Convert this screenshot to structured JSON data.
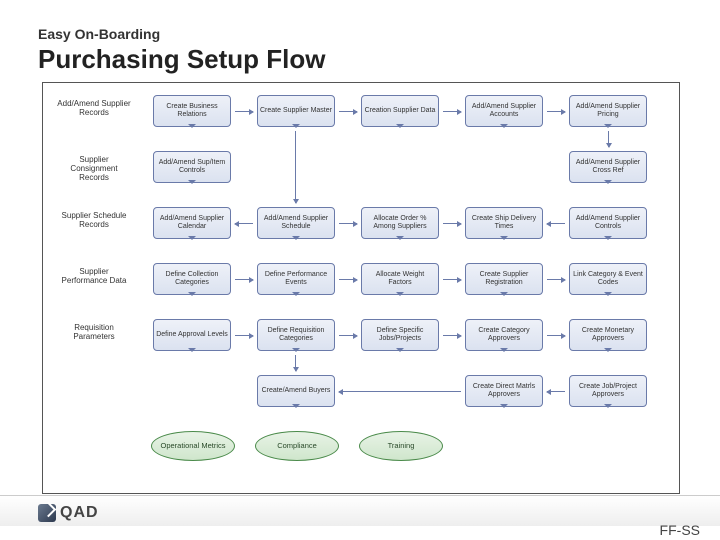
{
  "subtitle": "Easy On-Boarding",
  "title": "Purchasing Setup Flow",
  "logo": "QAD",
  "code": "FF-SS",
  "rowLabels": [
    "Add/Amend Supplier Records",
    "Supplier Consignment Records",
    "Supplier Schedule Records",
    "Supplier Performance Data",
    "Requisition Parameters"
  ],
  "rows": [
    [
      "Create Business Relations",
      "Create Supplier Master",
      "Creation Supplier Data",
      "Add/Amend Supplier Accounts",
      "Add/Amend Supplier Pricing"
    ],
    [
      "Add/Amend Sup/Item Controls",
      "",
      "",
      "",
      "Add/Amend Supplier Cross Ref"
    ],
    [
      "Add/Amend Supplier Calendar",
      "Add/Amend Supplier Schedule",
      "Allocate Order % Among Suppliers",
      "Create Ship Delivery Times",
      "Add/Amend Supplier Controls"
    ],
    [
      "Define Collection Categories",
      "Define Performance Events",
      "Allocate Weight Factors",
      "Create Supplier Registration",
      "Link Category & Event Codes"
    ],
    [
      "Define Approval Levels",
      "Define Requisition Categories",
      "Define Specific Jobs/Projects",
      "Create Category Approvers",
      "Create Monetary Approvers"
    ],
    [
      "",
      "Create/Amend Buyers",
      "",
      "Create Direct Matrls Approvers",
      "Create Job/Project Approvers"
    ]
  ],
  "ovals": [
    "Operational Metrics",
    "Compliance",
    "Training"
  ],
  "chart_data": {
    "type": "flowchart",
    "title": "Purchasing Setup Flow",
    "swimlanes": [
      {
        "label": "Add/Amend Supplier Records",
        "nodes": [
          "Create Business Relations",
          "Create Supplier Master",
          "Creation Supplier Data",
          "Add/Amend Supplier Accounts",
          "Add/Amend Supplier Pricing"
        ],
        "flow": "left-to-right"
      },
      {
        "label": "Supplier Consignment Records",
        "nodes": [
          "Add/Amend Sup/Item Controls",
          "Add/Amend Supplier Cross Ref"
        ]
      },
      {
        "label": "Supplier Schedule Records",
        "nodes": [
          "Add/Amend Supplier Calendar",
          "Add/Amend Supplier Schedule",
          "Allocate Order % Among Suppliers",
          "Create Ship Delivery Times",
          "Add/Amend Supplier Controls"
        ]
      },
      {
        "label": "Supplier Performance Data",
        "nodes": [
          "Define Collection Categories",
          "Define Performance Events",
          "Allocate Weight Factors",
          "Create Supplier Registration",
          "Link Category & Event Codes"
        ]
      },
      {
        "label": "Requisition Parameters",
        "nodes": [
          "Define Approval Levels",
          "Define Requisition Categories",
          "Define Specific Jobs/Projects",
          "Create Category Approvers",
          "Create Monetary Approvers"
        ]
      },
      {
        "label": "",
        "nodes": [
          "Create/Amend Buyers",
          "Create Direct Matrls Approvers",
          "Create Job/Project Approvers"
        ]
      }
    ],
    "terminals": [
      "Operational Metrics",
      "Compliance",
      "Training"
    ],
    "edges": [
      {
        "from": "Create Business Relations",
        "to": "Create Supplier Master"
      },
      {
        "from": "Create Supplier Master",
        "to": "Creation Supplier Data"
      },
      {
        "from": "Creation Supplier Data",
        "to": "Add/Amend Supplier Accounts"
      },
      {
        "from": "Add/Amend Supplier Accounts",
        "to": "Add/Amend Supplier Pricing"
      },
      {
        "from": "Add/Amend Supplier Pricing",
        "to": "Add/Amend Supplier Cross Ref"
      },
      {
        "from": "Create Supplier Master",
        "to": "Add/Amend Sup/Item Controls"
      },
      {
        "from": "Add/Amend Sup/Item Controls",
        "to": "Add/Amend Supplier Schedule"
      },
      {
        "from": "Add/Amend Supplier Schedule",
        "to": "Add/Amend Supplier Calendar"
      },
      {
        "from": "Add/Amend Supplier Schedule",
        "to": "Allocate Order % Among Suppliers"
      },
      {
        "from": "Allocate Order % Among Suppliers",
        "to": "Create Ship Delivery Times"
      },
      {
        "from": "Add/Amend Supplier Controls",
        "to": "Create Ship Delivery Times"
      },
      {
        "from": "Define Collection Categories",
        "to": "Define Performance Events"
      },
      {
        "from": "Define Performance Events",
        "to": "Allocate Weight Factors"
      },
      {
        "from": "Allocate Weight Factors",
        "to": "Create Supplier Registration"
      },
      {
        "from": "Create Supplier Registration",
        "to": "Link Category & Event Codes"
      },
      {
        "from": "Define Approval Levels",
        "to": "Define Requisition Categories"
      },
      {
        "from": "Define Requisition Categories",
        "to": "Define Specific Jobs/Projects"
      },
      {
        "from": "Define Specific Jobs/Projects",
        "to": "Create Category Approvers"
      },
      {
        "from": "Create Category Approvers",
        "to": "Create Monetary Approvers"
      },
      {
        "from": "Define Requisition Categories",
        "to": "Create/Amend Buyers"
      },
      {
        "from": "Create Job/Project Approvers",
        "to": "Create Direct Matrls Approvers"
      },
      {
        "from": "Create Direct Matrls Approvers",
        "to": "Create/Amend Buyers"
      }
    ]
  }
}
